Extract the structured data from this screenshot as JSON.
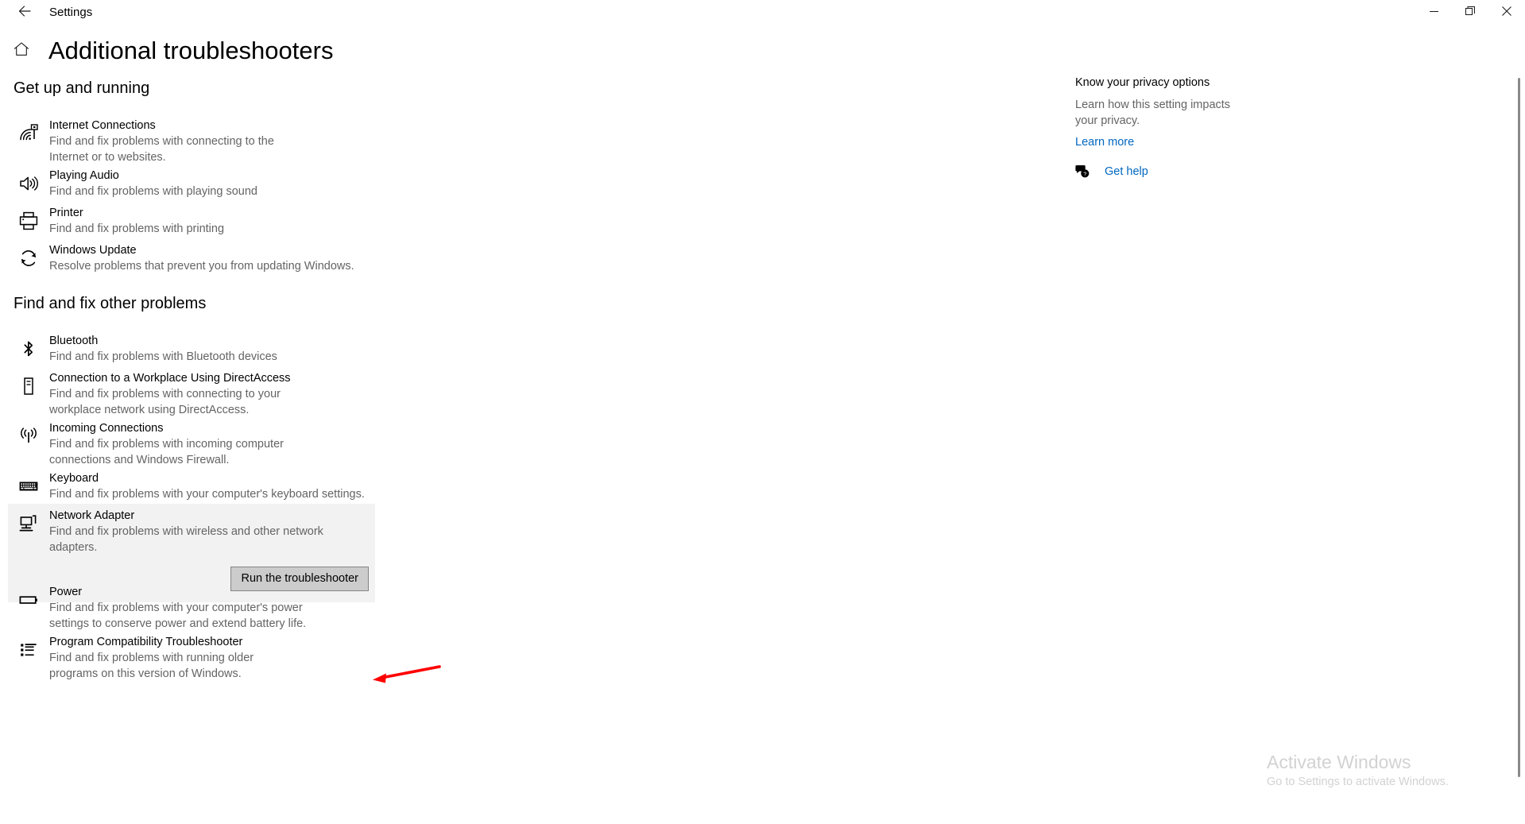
{
  "window": {
    "app_title": "Settings",
    "back_icon": "back-arrow-icon",
    "minimize_label": "—",
    "maximize_label": "❐",
    "close_label": "✕"
  },
  "header": {
    "home_icon": "home-icon",
    "title": "Additional troubleshooters"
  },
  "sections": [
    {
      "heading": "Get up and running",
      "items": [
        {
          "icon": "wifi-signal-icon",
          "title": "Internet Connections",
          "desc": "Find and fix problems with connecting to the Internet or to websites."
        },
        {
          "icon": "speaker-icon",
          "title": "Playing Audio",
          "desc": "Find and fix problems with playing sound"
        },
        {
          "icon": "printer-icon",
          "title": "Printer",
          "desc": "Find and fix problems with printing"
        },
        {
          "icon": "refresh-sync-icon",
          "title": "Windows Update",
          "desc": "Resolve problems that prevent you from updating Windows."
        }
      ]
    },
    {
      "heading": "Find and fix other problems",
      "items": [
        {
          "icon": "bluetooth-icon",
          "title": "Bluetooth",
          "desc": "Find and fix problems with Bluetooth devices"
        },
        {
          "icon": "mobile-device-icon",
          "title": "Connection to a Workplace Using DirectAccess",
          "desc": "Find and fix problems with connecting to your workplace network using DirectAccess."
        },
        {
          "icon": "broadcast-tower-icon",
          "title": "Incoming Connections",
          "desc": "Find and fix problems with incoming computer connections and Windows Firewall."
        },
        {
          "icon": "keyboard-icon",
          "title": "Keyboard",
          "desc": "Find and fix problems with your computer's keyboard settings."
        },
        {
          "icon": "network-adapter-icon",
          "title": "Network Adapter",
          "desc": "Find and fix problems with wireless and other network adapters.",
          "selected": true,
          "action_label": "Run the troubleshooter"
        },
        {
          "icon": "battery-icon",
          "title": "Power",
          "desc": "Find and fix problems with your computer's power settings to conserve power and extend battery life."
        },
        {
          "icon": "list-icon",
          "title": "Program Compatibility Troubleshooter",
          "desc": "Find and fix problems with running older programs on this version of Windows."
        }
      ]
    }
  ],
  "right_rail": {
    "heading": "Know your privacy options",
    "desc": "Learn how this setting impacts your privacy.",
    "link": "Learn more",
    "get_help_icon": "help-chat-icon",
    "get_help": "Get help"
  },
  "watermark": {
    "title": "Activate Windows",
    "subtitle": "Go to Settings to activate Windows."
  },
  "colors": {
    "accent_link": "#0067c0",
    "selected_row_bg": "#f2f2f2",
    "button_bg": "#cccccc",
    "button_border": "#848484",
    "annotation_red": "#ff0000",
    "secondary_text": "#646464",
    "watermark_text": "#d2d2d2"
  },
  "annotation": {
    "arrow": "red-pointer-arrow",
    "points_to": "Run the troubleshooter"
  }
}
